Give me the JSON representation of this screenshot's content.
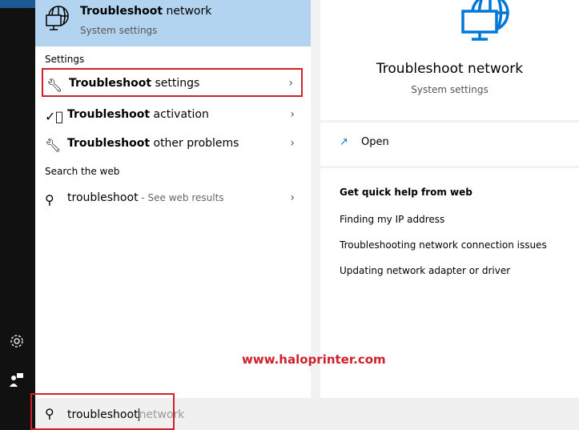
{
  "best_match": {
    "title_bold": "Troubleshoot",
    "title_rest": " network",
    "subtitle": "System settings",
    "icon": "network-troubleshoot-icon"
  },
  "settings_header": "Settings",
  "settings_items": [
    {
      "bold": "Troubleshoot",
      "rest": " settings",
      "icon": "wrench-icon",
      "highlighted": true
    },
    {
      "bold": "Troubleshoot",
      "rest": " activation",
      "icon": "check-circle-icon"
    },
    {
      "bold": "Troubleshoot",
      "rest": " other problems",
      "icon": "wrench-icon"
    }
  ],
  "web_header": "Search the web",
  "web_item": {
    "query": "troubleshoot",
    "suffix": " - See web results"
  },
  "preview": {
    "title": "Troubleshoot network",
    "subtitle": "System settings",
    "open_label": "Open",
    "help_header": "Get quick help from web",
    "help_links": [
      "Finding my IP address",
      "Troubleshooting network connection issues",
      "Updating network adapter or driver"
    ]
  },
  "watermark": "www.haloprinter.com",
  "search": {
    "typed": "troubleshoot",
    "suggestion": "network"
  },
  "colors": {
    "accent": "#0078d7",
    "highlight": "#d0202a",
    "selected_bg": "#b3d4f0"
  }
}
